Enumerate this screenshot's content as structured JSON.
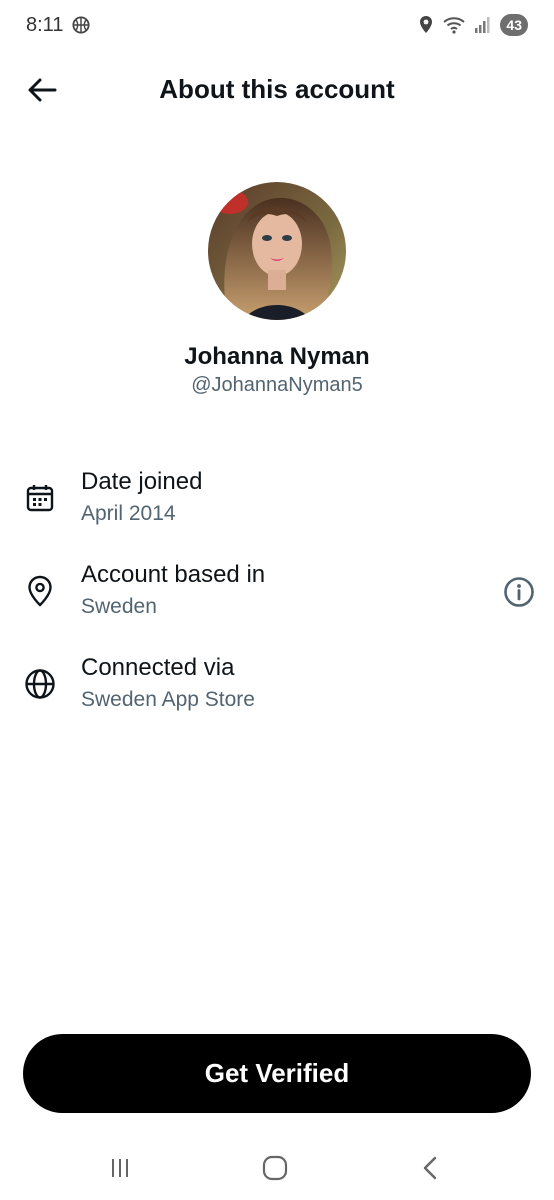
{
  "status_bar": {
    "time": "8:11",
    "battery": "43",
    "icons": [
      "basketball-icon",
      "location-icon",
      "wifi-icon",
      "signal-icon",
      "battery-icon"
    ]
  },
  "header": {
    "title": "About this account",
    "back_icon": "back-arrow-icon"
  },
  "profile": {
    "display_name": "Johanna Nyman",
    "username": "@JohannaNyman5"
  },
  "details": [
    {
      "icon": "calendar-icon",
      "title": "Date joined",
      "value": "April 2014"
    },
    {
      "icon": "location-pin-icon",
      "title": "Account based in",
      "value": "Sweden",
      "info_icon": "info-icon"
    },
    {
      "icon": "globe-icon",
      "title": "Connected via",
      "value": "Sweden App Store"
    }
  ],
  "actions": {
    "verify_label": "Get Verified"
  },
  "nav_bar": {
    "icons": [
      "recent-apps-icon",
      "home-icon",
      "back-icon"
    ]
  },
  "colors": {
    "primary_text": "#0f1419",
    "secondary_text": "#536471",
    "button_bg": "#000000",
    "button_text": "#ffffff"
  }
}
